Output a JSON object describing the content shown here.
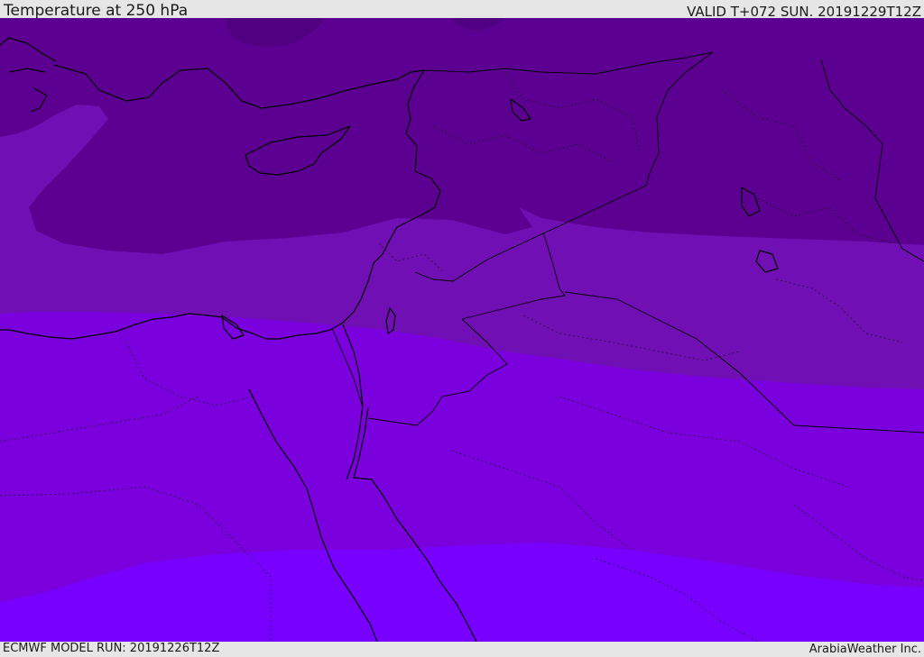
{
  "header": {
    "title": "Temperature at 250 hPa",
    "valid_time": "VALID T+072 SUN. 20191229T12Z"
  },
  "footer": {
    "model_run": "ECMWF MODEL RUN: 20191226T12Z",
    "credit": "ArabiaWeather Inc."
  },
  "colors": {
    "band_coldest": "#5c0092",
    "band_cold": "#7010b4",
    "band_mid": "#7a00de",
    "band_warm": "#7800fe",
    "coastline": "#000000",
    "background": "#e6e6e6"
  }
}
